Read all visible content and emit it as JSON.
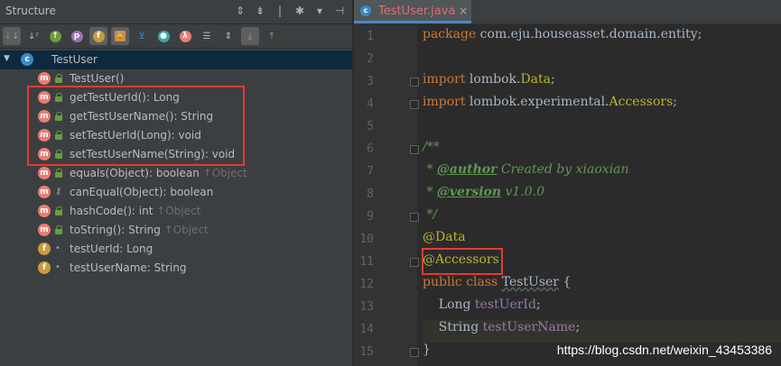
{
  "structure": {
    "title": "Structure",
    "root": "TestUser",
    "items": [
      {
        "kind": "m",
        "vis": "lock",
        "label": "TestUser()",
        "suffix": ""
      },
      {
        "kind": "m",
        "vis": "lock",
        "label": "getTestUerId(): Long",
        "suffix": ""
      },
      {
        "kind": "m",
        "vis": "lock",
        "label": "getTestUserName(): String",
        "suffix": ""
      },
      {
        "kind": "m",
        "vis": "lock",
        "label": "setTestUerId(Long): void",
        "suffix": ""
      },
      {
        "kind": "m",
        "vis": "lock",
        "label": "setTestUserName(String): void",
        "suffix": ""
      },
      {
        "kind": "m",
        "vis": "lock",
        "label": "equals(Object): boolean",
        "suffix": "↑Object"
      },
      {
        "kind": "m",
        "vis": "key",
        "label": "canEqual(Object): boolean",
        "suffix": ""
      },
      {
        "kind": "m",
        "vis": "lock",
        "label": "hashCode(): int",
        "suffix": "↑Object"
      },
      {
        "kind": "m",
        "vis": "lock",
        "label": "toString(): String",
        "suffix": "↑Object"
      },
      {
        "kind": "f",
        "vis": "dot",
        "label": "testUerId: Long",
        "suffix": ""
      },
      {
        "kind": "f",
        "vis": "dot",
        "label": "testUserName: String",
        "suffix": ""
      }
    ]
  },
  "editor": {
    "tab_label": "TestUser.java",
    "line_numbers": [
      "1",
      "2",
      "3",
      "4",
      "5",
      "6",
      "7",
      "8",
      "9",
      "10",
      "11",
      "12",
      "13",
      "14",
      "15"
    ],
    "code": {
      "l1_kw": "package",
      "l1_rest": " com.eju.houseasset.domain.entity;",
      "l3_kw": "import",
      "l3_rest1": " lombok.",
      "l3_ann": "Data",
      "l3_end": ";",
      "l4_kw": "import",
      "l4_rest1": " lombok.experimental.",
      "l4_ann": "Accessors",
      "l4_end": ";",
      "l6": "/**",
      "l7_star": " * ",
      "l7_tag": "@author",
      "l7_rest": " Created by xiaoxian",
      "l8_star": " * ",
      "l8_tag": "@version",
      "l8_rest": " v1.0.0",
      "l9": " */",
      "l10": "@Data",
      "l11": "@Accessors",
      "l12_kw1": "public",
      "l12_kw2": " class ",
      "l12_cls": "TestUser",
      "l12_end": " {",
      "l13_type": "    Long ",
      "l13_field": "testUerId",
      "l13_end": ";",
      "l14_type": "    String ",
      "l14_field": "testUserName",
      "l14_end": ";",
      "l15": "}"
    }
  },
  "watermark": "https://blog.csdn.net/weixin_43453386"
}
